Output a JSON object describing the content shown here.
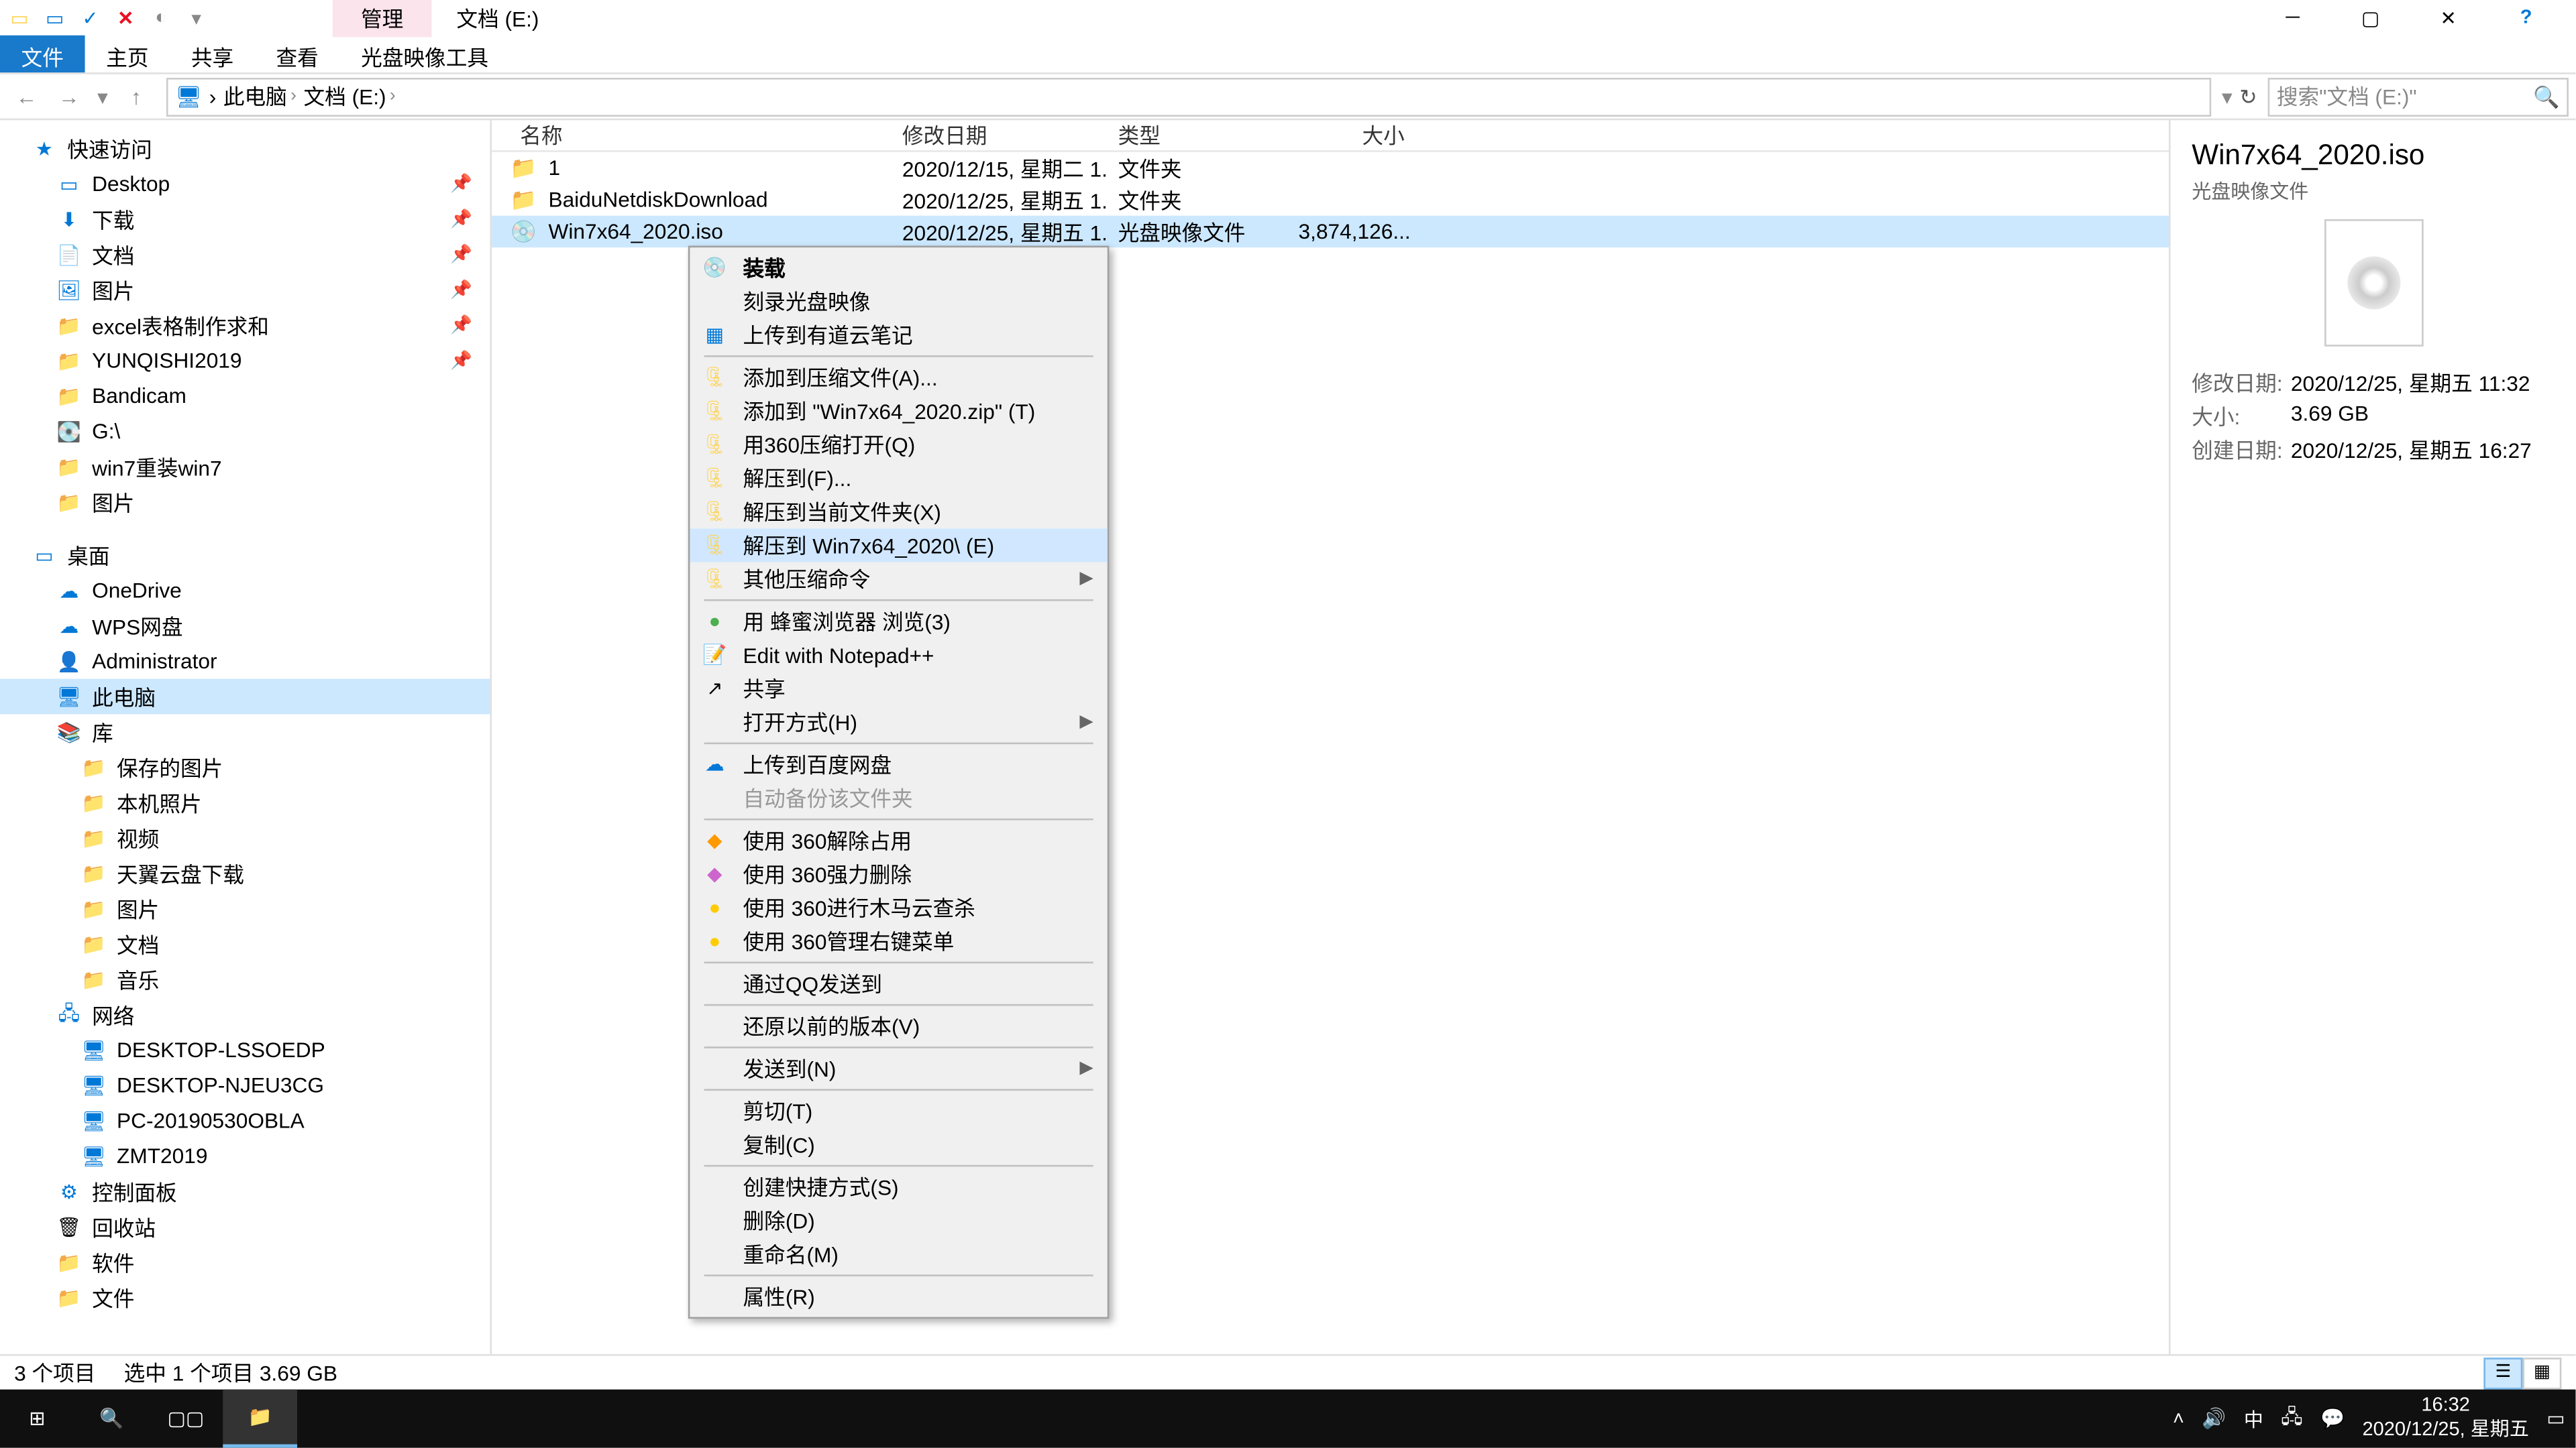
{
  "titlebar": {
    "context_tab": "管理",
    "title": "文档 (E:)"
  },
  "ribbon": {
    "file": "文件",
    "home": "主页",
    "share": "共享",
    "view": "查看",
    "disc_tools": "光盘映像工具"
  },
  "address": {
    "pc": "此电脑",
    "drive": "文档 (E:)",
    "search_placeholder": "搜索\"文档 (E:)\""
  },
  "nav": {
    "quick_access": "快速访问",
    "desktop": "Desktop",
    "downloads": "下载",
    "documents": "文档",
    "pictures": "图片",
    "excel": "excel表格制作求和",
    "yunqishi": "YUNQISHI2019",
    "bandicam": "Bandicam",
    "g_drive": "G:\\",
    "win7reload": "win7重装win7",
    "pictures2": "图片",
    "desktop_zh": "桌面",
    "onedrive": "OneDrive",
    "wps": "WPS网盘",
    "admin": "Administrator",
    "this_pc": "此电脑",
    "libraries": "库",
    "saved_pics": "保存的图片",
    "local_pics": "本机照片",
    "videos": "视频",
    "tianyi": "天翼云盘下载",
    "lib_pictures": "图片",
    "lib_docs": "文档",
    "lib_music": "音乐",
    "network": "网络",
    "pc1": "DESKTOP-LSSOEDP",
    "pc2": "DESKTOP-NJEU3CG",
    "pc3": "PC-20190530OBLA",
    "pc4": "ZMT2019",
    "control_panel": "控制面板",
    "recycle": "回收站",
    "software": "软件",
    "files": "文件"
  },
  "columns": {
    "name": "名称",
    "date": "修改日期",
    "type": "类型",
    "size": "大小"
  },
  "files": [
    {
      "name": "1",
      "date": "2020/12/15, 星期二 1...",
      "type": "文件夹",
      "size": ""
    },
    {
      "name": "BaiduNetdiskDownload",
      "date": "2020/12/25, 星期五 1...",
      "type": "文件夹",
      "size": ""
    },
    {
      "name": "Win7x64_2020.iso",
      "date": "2020/12/25, 星期五 1...",
      "type": "光盘映像文件",
      "size": "3,874,126..."
    }
  ],
  "context_menu": {
    "mount": "装载",
    "burn": "刻录光盘映像",
    "youdao": "上传到有道云笔记",
    "add_archive": "添加到压缩文件(A)...",
    "add_zip": "添加到 \"Win7x64_2020.zip\" (T)",
    "open_360": "用360压缩打开(Q)",
    "extract_to": "解压到(F)...",
    "extract_here": "解压到当前文件夹(X)",
    "extract_named": "解压到 Win7x64_2020\\ (E)",
    "other_compress": "其他压缩命令",
    "honey_browser": "用 蜂蜜浏览器 浏览(3)",
    "notepad": "Edit with Notepad++",
    "share": "共享",
    "open_with": "打开方式(H)",
    "baidu_upload": "上传到百度网盘",
    "auto_backup": "自动备份该文件夹",
    "clear_360": "使用 360解除占用",
    "force_delete": "使用 360强力删除",
    "trojan_scan": "使用 360进行木马云查杀",
    "manage_menu": "使用 360管理右键菜单",
    "qq_send": "通过QQ发送到",
    "restore": "还原以前的版本(V)",
    "send_to": "发送到(N)",
    "cut": "剪切(T)",
    "copy": "复制(C)",
    "shortcut": "创建快捷方式(S)",
    "delete": "删除(D)",
    "rename": "重命名(M)",
    "properties": "属性(R)"
  },
  "details": {
    "title": "Win7x64_2020.iso",
    "type": "光盘映像文件",
    "mod_label": "修改日期:",
    "mod_val": "2020/12/25, 星期五 11:32",
    "size_label": "大小:",
    "size_val": "3.69 GB",
    "create_label": "创建日期:",
    "create_val": "2020/12/25, 星期五 16:27"
  },
  "status": {
    "count": "3 个项目",
    "selected": "选中 1 个项目  3.69 GB"
  },
  "taskbar": {
    "ime": "中",
    "time": "16:32",
    "date": "2020/12/25, 星期五"
  }
}
